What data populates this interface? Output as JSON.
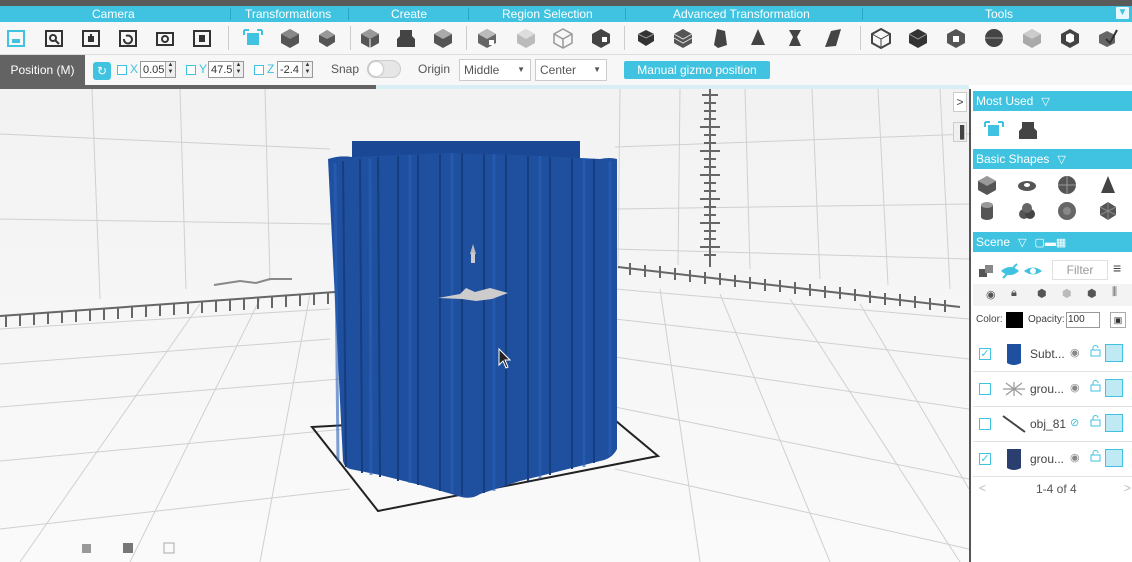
{
  "menu": {
    "sections": [
      "Camera",
      "Transformations",
      "Create",
      "Region Selection",
      "Advanced Transformation",
      "Tools"
    ],
    "collapse_icon": "chevron-down-icon"
  },
  "propbar": {
    "mode_label": "Position (M)",
    "x_label": "X",
    "x_value": "0.05",
    "y_label": "Y",
    "y_value": "47.5",
    "z_label": "Z",
    "z_value": "-2.4",
    "snap_label": "Snap",
    "origin_label": "Origin",
    "origin_value": "Middle",
    "center_value": "Center",
    "manual_gizmo_label": "Manual gizmo position"
  },
  "panel": {
    "most_used_label": "Most Used",
    "basic_shapes_label": "Basic Shapes",
    "scene_label": "Scene",
    "filter_placeholder": "Filter",
    "color_label": "Color:",
    "opacity_label": "Opacity:",
    "opacity_value": "100",
    "pagination": "1-4 of 4",
    "scene_items": [
      {
        "name": "Subt...",
        "checked": true
      },
      {
        "name": "grou...",
        "checked": false
      },
      {
        "name": "obj_81",
        "checked": false
      },
      {
        "name": "grou...",
        "checked": true
      }
    ]
  },
  "colors": {
    "accent": "#3fc3e0",
    "object": "#1f4f9f",
    "mode_bg": "#636363"
  }
}
